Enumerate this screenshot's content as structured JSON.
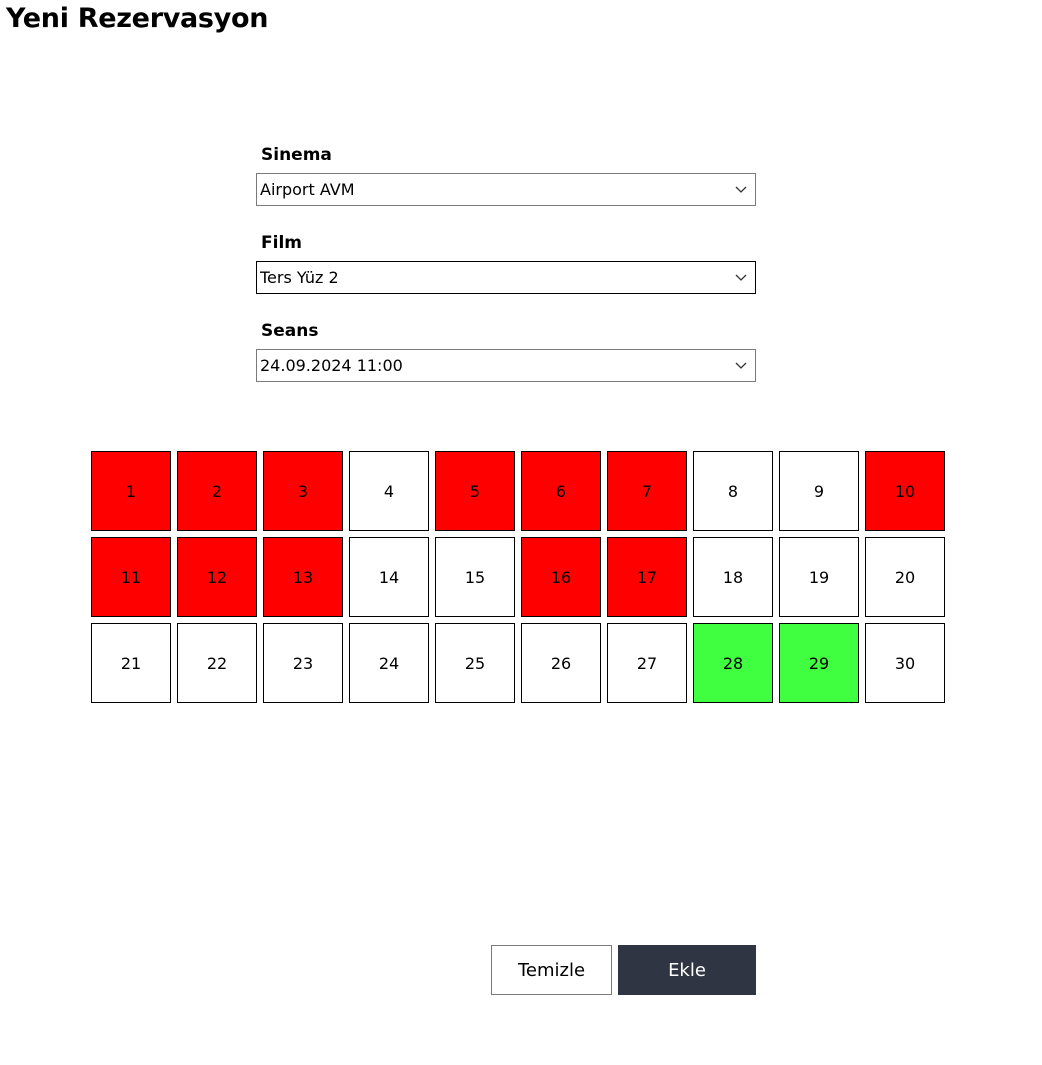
{
  "page_title": "Yeni Rezervasyon",
  "fields": {
    "cinema": {
      "label": "Sinema",
      "value": "Airport AVM"
    },
    "film": {
      "label": "Film",
      "value": "Ters Yüz 2"
    },
    "session": {
      "label": "Seans",
      "value": "24.09.2024 11:00"
    }
  },
  "seat_colors": {
    "reserved": "#ff0000",
    "selected": "#40ff40",
    "available": "#ffffff"
  },
  "seats": [
    {
      "number": "1",
      "status": "reserved"
    },
    {
      "number": "2",
      "status": "reserved"
    },
    {
      "number": "3",
      "status": "reserved"
    },
    {
      "number": "4",
      "status": "available"
    },
    {
      "number": "5",
      "status": "reserved"
    },
    {
      "number": "6",
      "status": "reserved"
    },
    {
      "number": "7",
      "status": "reserved"
    },
    {
      "number": "8",
      "status": "available"
    },
    {
      "number": "9",
      "status": "available"
    },
    {
      "number": "10",
      "status": "reserved"
    },
    {
      "number": "11",
      "status": "reserved"
    },
    {
      "number": "12",
      "status": "reserved"
    },
    {
      "number": "13",
      "status": "reserved"
    },
    {
      "number": "14",
      "status": "available"
    },
    {
      "number": "15",
      "status": "available"
    },
    {
      "number": "16",
      "status": "reserved"
    },
    {
      "number": "17",
      "status": "reserved"
    },
    {
      "number": "18",
      "status": "available"
    },
    {
      "number": "19",
      "status": "available"
    },
    {
      "number": "20",
      "status": "available"
    },
    {
      "number": "21",
      "status": "available"
    },
    {
      "number": "22",
      "status": "available"
    },
    {
      "number": "23",
      "status": "available"
    },
    {
      "number": "24",
      "status": "available"
    },
    {
      "number": "25",
      "status": "available"
    },
    {
      "number": "26",
      "status": "available"
    },
    {
      "number": "27",
      "status": "available"
    },
    {
      "number": "28",
      "status": "selected"
    },
    {
      "number": "29",
      "status": "selected"
    },
    {
      "number": "30",
      "status": "available"
    }
  ],
  "buttons": {
    "clear_label": "Temizle",
    "add_label": "Ekle",
    "add_color": "#2f3542"
  },
  "icons": {
    "dropdown": "chevron-down-icon"
  }
}
